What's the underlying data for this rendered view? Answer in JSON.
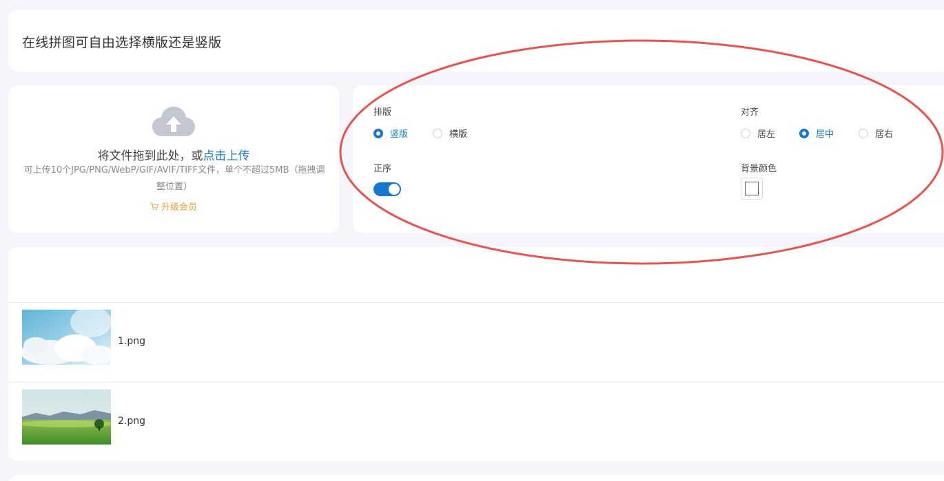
{
  "header": {
    "title": "在线拼图可自由选择横版还是竖版"
  },
  "upload": {
    "main_text": "将文件拖到此处，或",
    "link_text": "点击上传",
    "hint": "可上传10个JPG/PNG/WebP/GIF/AVIF/TIFF文件，单个不超过5MB（拖拽调整位置）",
    "vip_text": "升级会员",
    "cloud_icon": "cloud-upload-icon",
    "vip_icon": "cart-icon"
  },
  "settings": {
    "layout": {
      "label": "排版",
      "options": [
        "竖版",
        "横版"
      ],
      "selected": "竖版"
    },
    "align": {
      "label": "对齐",
      "options": [
        "居左",
        "居中",
        "居右"
      ],
      "selected": "居中"
    },
    "order": {
      "label": "正序",
      "enabled": true
    },
    "bg_color": {
      "label": "背景颜色",
      "value": "#ffffff"
    }
  },
  "files": [
    {
      "name": "1.png"
    },
    {
      "name": "2.png"
    }
  ],
  "colors": {
    "accent": "#1677d2",
    "vip": "#e8a13a",
    "annotation": "#e8534f"
  }
}
